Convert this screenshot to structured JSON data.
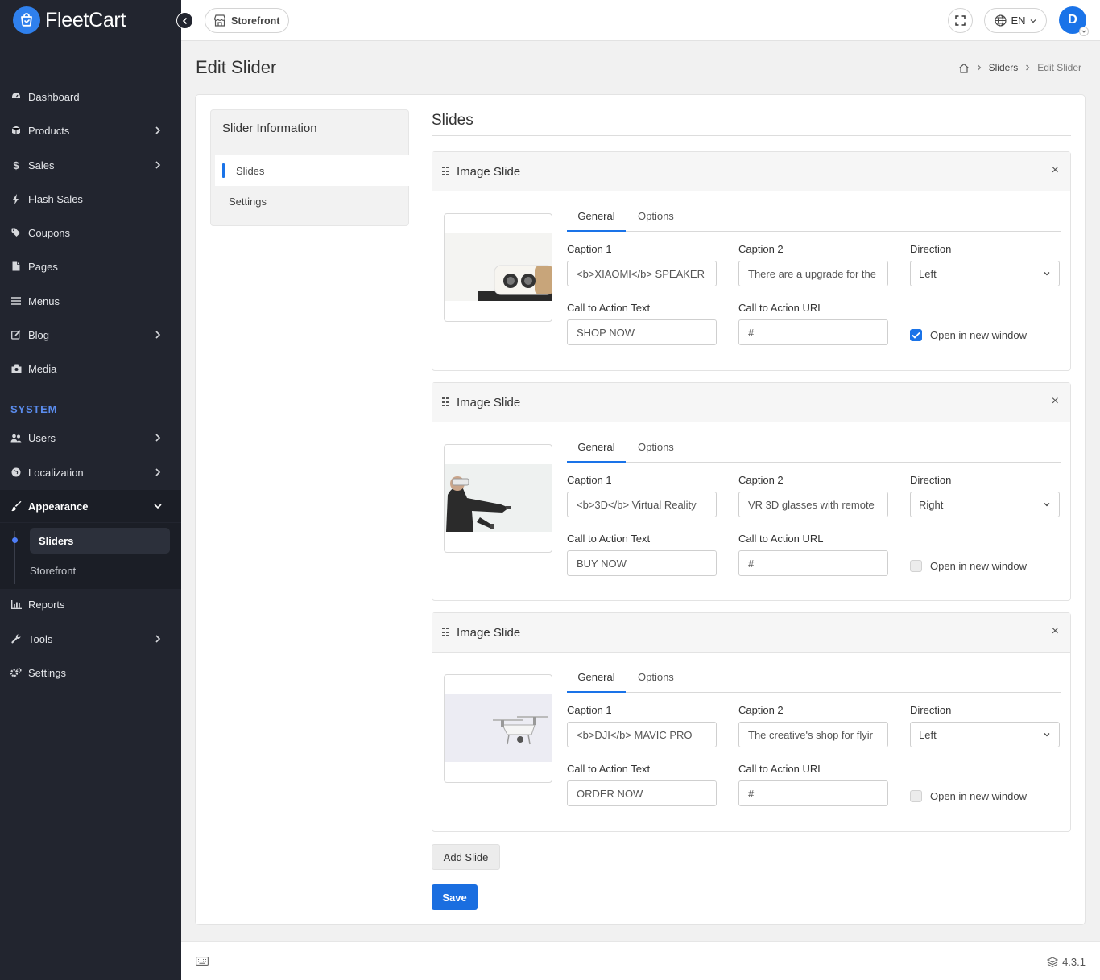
{
  "app": {
    "name": "FleetCart"
  },
  "sidebar": {
    "items": [
      {
        "label": "Dashboard",
        "icon": "dashboard-icon"
      },
      {
        "label": "Products",
        "icon": "cube-icon"
      },
      {
        "label": "Sales",
        "icon": "dollar-icon"
      },
      {
        "label": "Flash Sales",
        "icon": "bolt-icon"
      },
      {
        "label": "Coupons",
        "icon": "tags-icon"
      },
      {
        "label": "Pages",
        "icon": "file-icon"
      },
      {
        "label": "Menus",
        "icon": "bars-icon"
      },
      {
        "label": "Blog",
        "icon": "edit-icon"
      },
      {
        "label": "Media",
        "icon": "camera-icon"
      }
    ],
    "system_title": "SYSTEM",
    "system_items": [
      {
        "label": "Users",
        "icon": "users-icon"
      },
      {
        "label": "Localization",
        "icon": "globe-icon"
      },
      {
        "label": "Appearance",
        "icon": "paintbrush-icon"
      },
      {
        "label": "Reports",
        "icon": "bar-chart-icon"
      },
      {
        "label": "Tools",
        "icon": "wrench-icon"
      },
      {
        "label": "Settings",
        "icon": "cogs-icon"
      }
    ],
    "appearance_sub": {
      "active": "Sliders",
      "other": "Storefront"
    }
  },
  "topbar": {
    "storefront": "Storefront",
    "language": "EN",
    "avatar_initial": "D"
  },
  "page": {
    "title": "Edit Slider",
    "breadcrumb": {
      "sliders": "Sliders",
      "current": "Edit Slider"
    }
  },
  "info_panel": {
    "title": "Slider Information",
    "tabs": [
      "Slides",
      "Settings"
    ]
  },
  "slides_section": {
    "title": "Slides",
    "slide_title": "Image Slide",
    "tab_general": "General",
    "tab_options": "Options",
    "labels": {
      "caption1": "Caption 1",
      "caption2": "Caption 2",
      "direction": "Direction",
      "cta_text": "Call to Action Text",
      "cta_url": "Call to Action URL",
      "new_window": "Open in new window"
    },
    "slides": [
      {
        "caption1": "<b>XIAOMI</b> SPEAKER",
        "caption2": "There are a upgrade for the",
        "direction": "Left",
        "cta_text": "SHOP NOW",
        "cta_url": "#",
        "new_window": true,
        "image": "speaker"
      },
      {
        "caption1": "<b>3D</b> Virtual Reality",
        "caption2": "VR 3D glasses with remote",
        "direction": "Right",
        "cta_text": "BUY NOW",
        "cta_url": "#",
        "new_window": false,
        "image": "vr"
      },
      {
        "caption1": "<b>DJI</b> MAVIC PRO",
        "caption2": "The creative's shop for flyir",
        "direction": "Left",
        "cta_text": "ORDER NOW",
        "cta_url": "#",
        "new_window": false,
        "image": "drone"
      }
    ]
  },
  "buttons": {
    "add_slide": "Add Slide",
    "save": "Save"
  },
  "footer": {
    "version": "4.3.1"
  },
  "colors": {
    "sidebar_bg": "#22252f",
    "accent": "#1a73e8",
    "system_title": "#5b8def"
  }
}
